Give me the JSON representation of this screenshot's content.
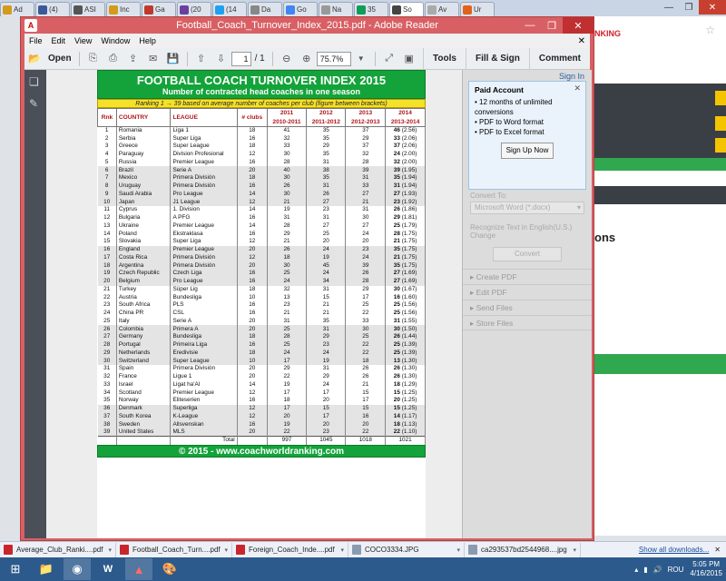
{
  "browser": {
    "tabs": [
      {
        "label": "Ad",
        "color": "#d39b1a"
      },
      {
        "label": "(4)",
        "color": "#3b5998"
      },
      {
        "label": "ASI",
        "color": "#555555"
      },
      {
        "label": "Inc",
        "color": "#d39b1a"
      },
      {
        "label": "Ga",
        "color": "#c0392b"
      },
      {
        "label": "(20",
        "color": "#6b3fa0"
      },
      {
        "label": "(14",
        "color": "#1da1f2"
      },
      {
        "label": "Da",
        "color": "#888888"
      },
      {
        "label": "Go",
        "color": "#4285f4"
      },
      {
        "label": "Na",
        "color": "#999999"
      },
      {
        "label": "35",
        "color": "#0f9d58"
      },
      {
        "label": "So",
        "color": "#444444"
      },
      {
        "label": "Av",
        "color": "#aaaaaa"
      },
      {
        "label": "Ur",
        "color": "#e2621b"
      }
    ],
    "active_tab_index": 11
  },
  "background_page": {
    "red_text": "NKING",
    "side_text": "ons"
  },
  "adobe": {
    "title": "Football_Coach_Turnover_Index_2015.pdf - Adobe Reader",
    "menu": [
      "File",
      "Edit",
      "View",
      "Window",
      "Help"
    ],
    "toolbar": {
      "open_label": "Open",
      "page_current": "1",
      "page_total": "/ 1",
      "zoom": "75.7%",
      "tools_label": "Tools",
      "fill_sign_label": "Fill & Sign",
      "comment_label": "Comment"
    }
  },
  "pdf": {
    "title": "FOOTBALL COACH TURNOVER INDEX 2015",
    "subtitle": "Number of contracted head coaches in one season",
    "ranking_note": "Ranking 1 → 39 based on average number of coaches per club (figure between brackets)",
    "headers": {
      "rank": "Rnk",
      "country": "COUNTRY",
      "league": "LEAGUE",
      "clubs": "# clubs",
      "y1_top": "2011",
      "y1_bot": "2010-2011",
      "y2_top": "2012",
      "y2_bot": "2011-2012",
      "y3_top": "2013",
      "y3_bot": "2012-2013",
      "y4_top": "2014",
      "y4_bot": "2013-2014"
    },
    "rows": [
      [
        "1",
        "Romania",
        "Liga 1",
        "18",
        "41",
        "35",
        "37",
        "46",
        "(2.56)"
      ],
      [
        "2",
        "Serbia",
        "Super Liga",
        "16",
        "32",
        "35",
        "29",
        "33",
        "(2.06)"
      ],
      [
        "3",
        "Greece",
        "Super League",
        "18",
        "33",
        "29",
        "37",
        "37",
        "(2.06)"
      ],
      [
        "4",
        "Paraguay",
        "Division Profesional",
        "12",
        "30",
        "35",
        "32",
        "24",
        "(2.00)"
      ],
      [
        "5",
        "Russia",
        "Premier League",
        "16",
        "28",
        "31",
        "28",
        "32",
        "(2.00)"
      ],
      [
        "6",
        "Brazil",
        "Serie A",
        "20",
        "40",
        "38",
        "39",
        "39",
        "(1.95)"
      ],
      [
        "7",
        "Mexico",
        "Primera División",
        "18",
        "30",
        "35",
        "31",
        "35",
        "(1.94)"
      ],
      [
        "8",
        "Uruguay",
        "Primera División",
        "16",
        "26",
        "31",
        "33",
        "31",
        "(1.94)"
      ],
      [
        "9",
        "Saudi Arabia",
        "Pro League",
        "14",
        "30",
        "26",
        "27",
        "27",
        "(1.93)"
      ],
      [
        "10",
        "Japan",
        "J1 League",
        "12",
        "21",
        "27",
        "21",
        "23",
        "(1.92)"
      ],
      [
        "11",
        "Cyprus",
        "1. Division",
        "14",
        "19",
        "23",
        "31",
        "26",
        "(1.86)"
      ],
      [
        "12",
        "Bulgaria",
        "A PFG",
        "16",
        "31",
        "31",
        "30",
        "29",
        "(1.81)"
      ],
      [
        "13",
        "Ukraine",
        "Premier League",
        "14",
        "28",
        "27",
        "27",
        "25",
        "(1.79)"
      ],
      [
        "14",
        "Poland",
        "Ekstraklasa",
        "16",
        "29",
        "25",
        "24",
        "28",
        "(1.75)"
      ],
      [
        "15",
        "Slovakia",
        "Super Liga",
        "12",
        "21",
        "20",
        "20",
        "21",
        "(1.75)"
      ],
      [
        "16",
        "England",
        "Premier League",
        "20",
        "26",
        "24",
        "23",
        "35",
        "(1.75)"
      ],
      [
        "17",
        "Costa Rica",
        "Primera División",
        "12",
        "18",
        "19",
        "24",
        "21",
        "(1.75)"
      ],
      [
        "18",
        "Argentina",
        "Primera División",
        "20",
        "30",
        "45",
        "39",
        "35",
        "(1.75)"
      ],
      [
        "19",
        "Czech Republic",
        "Czech Liga",
        "16",
        "25",
        "24",
        "26",
        "27",
        "(1.69)"
      ],
      [
        "20",
        "Belgium",
        "Pro League",
        "16",
        "24",
        "34",
        "28",
        "27",
        "(1.69)"
      ],
      [
        "21",
        "Turkey",
        "Süper Lig",
        "18",
        "32",
        "31",
        "29",
        "30",
        "(1.67)"
      ],
      [
        "22",
        "Austria",
        "Bundesliga",
        "10",
        "13",
        "15",
        "17",
        "16",
        "(1.60)"
      ],
      [
        "23",
        "South Africa",
        "PLS",
        "16",
        "23",
        "21",
        "25",
        "25",
        "(1.56)"
      ],
      [
        "24",
        "China PR",
        "CSL",
        "16",
        "21",
        "21",
        "22",
        "25",
        "(1.56)"
      ],
      [
        "25",
        "Italy",
        "Serie A",
        "20",
        "31",
        "35",
        "33",
        "31",
        "(1.55)"
      ],
      [
        "26",
        "Colombia",
        "Primera A",
        "20",
        "25",
        "31",
        "30",
        "30",
        "(1.50)"
      ],
      [
        "27",
        "Germany",
        "Bundesliga",
        "18",
        "28",
        "29",
        "25",
        "26",
        "(1.44)"
      ],
      [
        "28",
        "Portugal",
        "Primeira Liga",
        "16",
        "25",
        "23",
        "22",
        "25",
        "(1.39)"
      ],
      [
        "29",
        "Netherlands",
        "Eredivisie",
        "18",
        "24",
        "24",
        "22",
        "25",
        "(1.39)"
      ],
      [
        "30",
        "Switzerland",
        "Super League",
        "10",
        "17",
        "19",
        "18",
        "13",
        "(1.30)"
      ],
      [
        "31",
        "Spain",
        "Primera División",
        "20",
        "29",
        "31",
        "26",
        "26",
        "(1.30)"
      ],
      [
        "32",
        "France",
        "Ligue 1",
        "20",
        "22",
        "29",
        "26",
        "26",
        "(1.30)"
      ],
      [
        "33",
        "Israel",
        "Ligat ha'Al",
        "14",
        "19",
        "24",
        "21",
        "18",
        "(1.29)"
      ],
      [
        "34",
        "Scotland",
        "Premier League",
        "12",
        "17",
        "17",
        "15",
        "15",
        "(1.25)"
      ],
      [
        "35",
        "Norway",
        "Eliteserien",
        "16",
        "18",
        "20",
        "17",
        "20",
        "(1.25)"
      ],
      [
        "36",
        "Denmark",
        "Superliga",
        "12",
        "17",
        "15",
        "15",
        "15",
        "(1.25)"
      ],
      [
        "37",
        "South Korea",
        "K-League",
        "12",
        "20",
        "17",
        "16",
        "14",
        "(1.17)"
      ],
      [
        "38",
        "Sweden",
        "Allsvenskan",
        "16",
        "19",
        "20",
        "20",
        "18",
        "(1.13)"
      ],
      [
        "39",
        "United States",
        "MLS",
        "20",
        "22",
        "23",
        "22",
        "22",
        "(1.10)"
      ]
    ],
    "total_label": "Total",
    "totals": [
      "997",
      "1045",
      "1018",
      "1021"
    ],
    "footer": "© 2015 - www.coachworldranking.com"
  },
  "right_pane": {
    "sign_in": "Sign In",
    "paid_title": "Paid Account",
    "paid_items": [
      "12 months of unlimited conversions",
      "PDF to Word format",
      "PDF to Excel format"
    ],
    "signup_label": "Sign Up Now",
    "convert_to_label": "Convert To:",
    "convert_select": "Microsoft Word (*.docx)",
    "recognize_text": "Recognize Text in English(U.S.)",
    "change_link": "Change",
    "convert_button": "Convert",
    "sections": [
      "Create PDF",
      "Edit PDF",
      "Send Files",
      "Store Files"
    ]
  },
  "downloads": {
    "items": [
      "Average_Club_Ranki....pdf",
      "Football_Coach_Turn....pdf",
      "Foreign_Coach_Inde....pdf",
      "COCO3334.JPG",
      "ca293537bd2544968....jpg"
    ],
    "show_all": "Show all downloads..."
  },
  "taskbar": {
    "lang": "ROU",
    "time": "5:05 PM",
    "date": "4/16/2015"
  }
}
